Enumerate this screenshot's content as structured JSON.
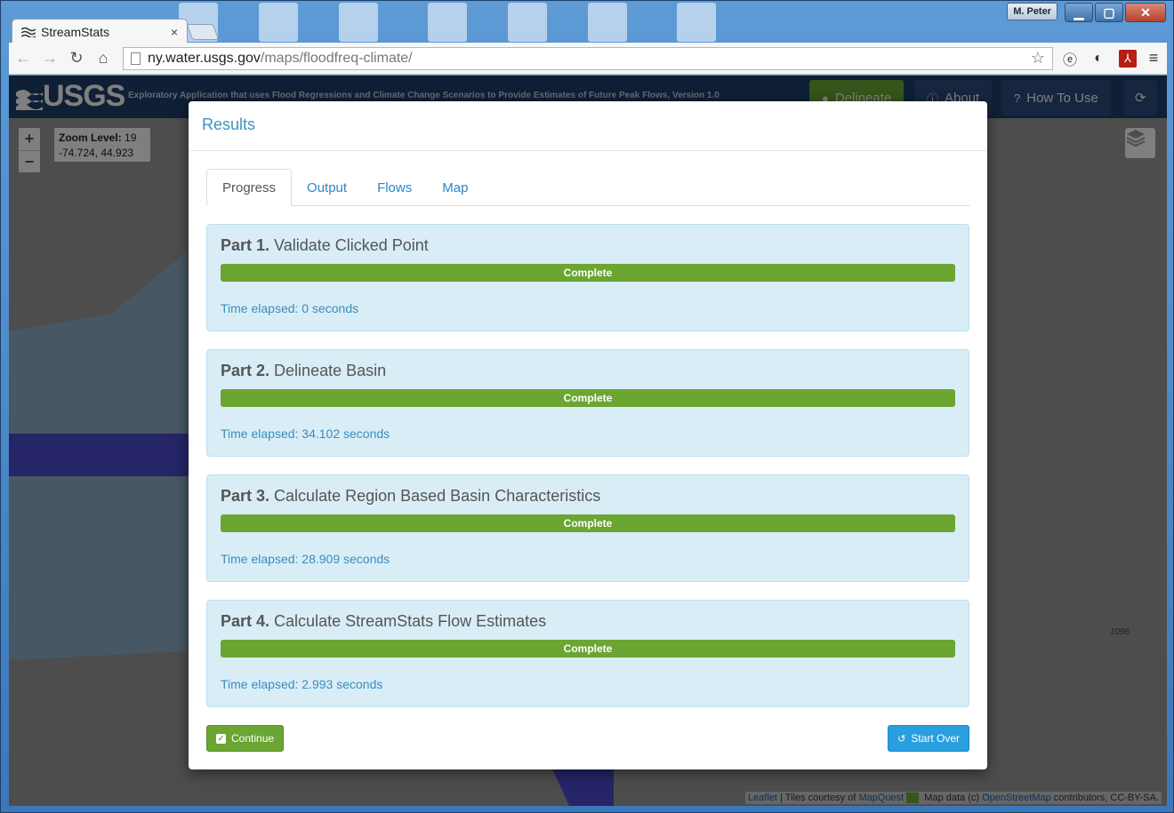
{
  "browser": {
    "tab_title": "StreamStats",
    "tab_close": "×",
    "user_badge": "M. Peter",
    "url_host": "ny.water.usgs.gov",
    "url_path": "/maps/floodfreq-climate/"
  },
  "header": {
    "logo_text": "USGS",
    "subtitle": "Exploratory Application that uses Flood Regressions and Climate Change Scenarios to Provide Estimates of Future Peak Flows, Version 1.0",
    "buttons": {
      "delineate": "Delineate",
      "about": "About",
      "how_to_use": "How To Use"
    }
  },
  "map": {
    "zoom_in": "+",
    "zoom_out": "−",
    "zoom_level_label": "Zoom Level:",
    "zoom_level_value": "19",
    "coordinates": "-74.724, 44.923",
    "feature_label": "1096",
    "attribution": {
      "leaflet": "Leaflet",
      "tiles_text": " | Tiles courtesy of ",
      "mapquest": "MapQuest",
      "data_text": " Map data (c) ",
      "osm": "OpenStreetMap",
      "license_text": " contributors, CC-BY-SA."
    }
  },
  "modal": {
    "title": "Results",
    "tabs": [
      {
        "label": "Progress"
      },
      {
        "label": "Output"
      },
      {
        "label": "Flows"
      },
      {
        "label": "Map"
      }
    ],
    "parts": [
      {
        "number": "Part 1.",
        "name": "Validate Clicked Point",
        "status": "Complete",
        "progress": 1.0,
        "elapsed": "Time elapsed: 0 seconds"
      },
      {
        "number": "Part 2.",
        "name": "Delineate Basin",
        "status": "Complete",
        "progress": 1.0,
        "elapsed": "Time elapsed: 34.102 seconds"
      },
      {
        "number": "Part 3.",
        "name": "Calculate Region Based Basin Characteristics",
        "status": "Complete",
        "progress": 1.0,
        "elapsed": "Time elapsed: 28.909 seconds"
      },
      {
        "number": "Part 4.",
        "name": "Calculate StreamStats Flow Estimates",
        "status": "Complete",
        "progress": 1.0,
        "elapsed": "Time elapsed: 2.993 seconds"
      }
    ],
    "continue_label": "Continue",
    "start_over_label": "Start Over"
  },
  "colors": {
    "header_bg": "#1e3f6a",
    "progress_green": "#6ba532",
    "panel_bg": "#d9edf7",
    "link_blue": "#2a87c8",
    "start_over_blue": "#2a9fe0"
  }
}
